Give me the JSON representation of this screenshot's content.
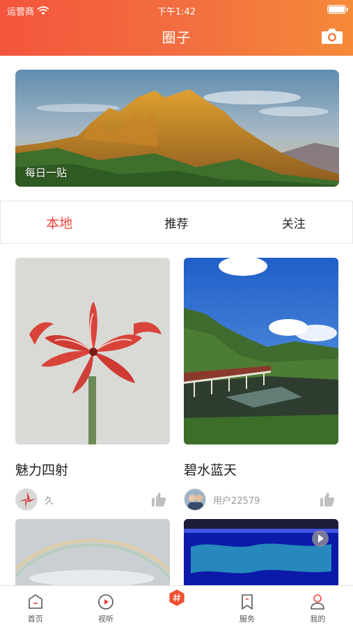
{
  "status": {
    "carrier": "运营商",
    "time": "下午1:42"
  },
  "header": {
    "title": "圈子"
  },
  "banner": {
    "caption": "每日一贴"
  },
  "tabs": [
    {
      "label": "本地",
      "active": true
    },
    {
      "label": "推荐",
      "active": false
    },
    {
      "label": "关注",
      "active": false
    }
  ],
  "posts": [
    {
      "title": "魅力四射",
      "user": "久",
      "image": "red-amaryllis-flower"
    },
    {
      "title": "碧水蓝天",
      "user": "用户22579",
      "image": "river-bridge-blue-sky"
    }
  ],
  "nav": [
    {
      "label": "首页",
      "icon": "home-icon"
    },
    {
      "label": "视听",
      "icon": "play-icon"
    },
    {
      "label": "",
      "icon": "hashtag-icon"
    },
    {
      "label": "服务",
      "icon": "bookmark-icon"
    },
    {
      "label": "我的",
      "icon": "user-icon"
    }
  ],
  "colors": {
    "accent": "#f0443a",
    "header_start": "#f4553c",
    "header_end": "#f58a38"
  }
}
